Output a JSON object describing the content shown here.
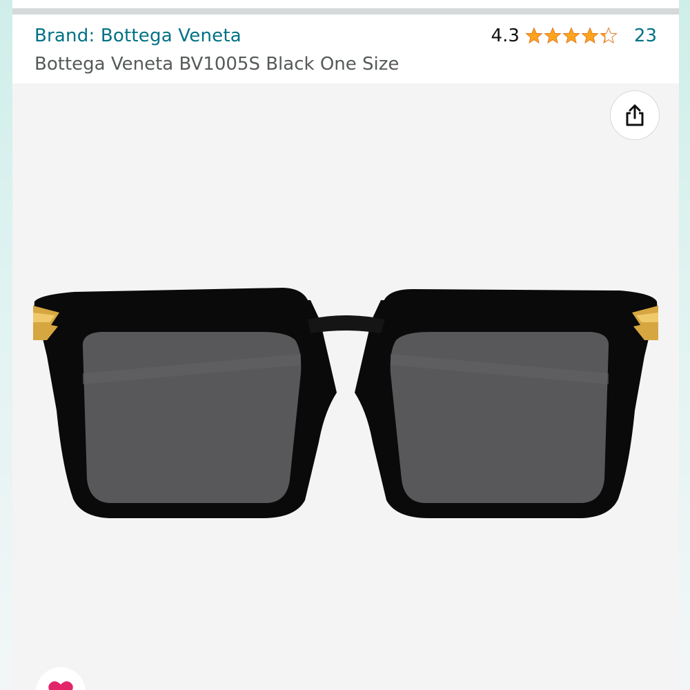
{
  "header": {
    "brand_link": "Brand: Bottega Veneta",
    "product_title": "Bottega Veneta BV1005S Black One Size"
  },
  "rating": {
    "value": "4.3",
    "stars": 4.3,
    "count": "23",
    "star_color": "#ffa41c"
  },
  "icons": {
    "share": "share-icon",
    "wishlist": "heart-icon"
  },
  "colors": {
    "link": "#007185",
    "text_secondary": "#565959",
    "heart": "#e3266a"
  }
}
